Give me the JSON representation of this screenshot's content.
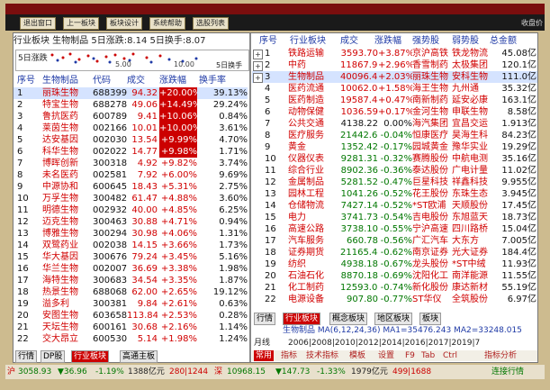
{
  "toolbar": {
    "buttons": [
      "退出窗口",
      "上一板块",
      "板块设计",
      "系统帮助",
      "选股列表"
    ]
  },
  "left": {
    "info_bar": "行业板块  生物制品  5日涨跌:8.14  5日换手:8.07",
    "chart_label": "5日涨跌",
    "axis_ticks": [
      "5.00",
      "10.00"
    ],
    "axis_right": "5日换手",
    "columns": [
      "序号",
      "生物制品",
      "代码",
      "成交",
      "涨跌幅",
      "换手率"
    ],
    "rows": [
      [
        "1",
        "丽珠生物",
        "688399",
        "94.32",
        "+20.00%",
        "39.13%"
      ],
      [
        "2",
        "特宝生物",
        "688278",
        "49.06",
        "+14.49%",
        "29.24%"
      ],
      [
        "3",
        "鲁抗医药",
        "600789",
        "9.41",
        "+10.06%",
        "0.84%"
      ],
      [
        "4",
        "莱茵生物",
        "002166",
        "10.01",
        "+10.00%",
        "3.61%"
      ],
      [
        "5",
        "达安基因",
        "002030",
        "13.54",
        "+9.99%",
        "4.70%"
      ],
      [
        "6",
        "科华生物",
        "002022",
        "14.77",
        "+9.98%",
        "1.71%"
      ],
      [
        "7",
        "博晖创新",
        "300318",
        "4.92",
        "+9.82%",
        "3.74%"
      ],
      [
        "8",
        "未名医药",
        "002581",
        "7.92",
        "+6.00%",
        "9.69%"
      ],
      [
        "9",
        "中源协和",
        "600645",
        "18.43",
        "+5.31%",
        "2.75%"
      ],
      [
        "10",
        "万孚生物",
        "300482",
        "61.47",
        "+4.88%",
        "3.60%"
      ],
      [
        "11",
        "明德生物",
        "002932",
        "40.00",
        "+4.85%",
        "6.25%"
      ],
      [
        "12",
        "迈克生物",
        "300463",
        "30.88",
        "+4.71%",
        "0.94%"
      ],
      [
        "13",
        "博雅生物",
        "300294",
        "30.98",
        "+4.06%",
        "1.31%"
      ],
      [
        "14",
        "双鹭药业",
        "002038",
        "14.15",
        "+3.66%",
        "1.73%"
      ],
      [
        "15",
        "华大基因",
        "300676",
        "79.24",
        "+3.45%",
        "5.16%"
      ],
      [
        "16",
        "华兰生物",
        "002007",
        "36.69",
        "+3.38%",
        "1.98%"
      ],
      [
        "17",
        "海特生物",
        "300683",
        "34.54",
        "+3.35%",
        "1.87%"
      ],
      [
        "18",
        "热景生物",
        "688068",
        "62.00",
        "+2.65%",
        "19.12%"
      ],
      [
        "19",
        "溢多利",
        "300381",
        "9.84",
        "+2.61%",
        "0.63%"
      ],
      [
        "20",
        "安图生物",
        "603658",
        "113.84",
        "+2.53%",
        "0.28%"
      ],
      [
        "21",
        "天坛生物",
        "600161",
        "30.68",
        "+2.16%",
        "1.14%"
      ],
      [
        "22",
        "交大昂立",
        "600530",
        "5.14",
        "+1.98%",
        "1.24%"
      ]
    ],
    "tabs": [
      "行情",
      "DP股",
      "行业板块",
      "高通主板"
    ]
  },
  "right": {
    "columns": [
      "序号",
      "行业板块",
      "成交",
      "涨跌幅",
      "强势股",
      "弱势股",
      "总金额"
    ],
    "rows": [
      [
        "1",
        "铁路运输",
        "3593.70",
        "+3.87%",
        "京沪高铁",
        "铁龙物流",
        "45.08亿"
      ],
      [
        "2",
        "中药",
        "11867.99",
        "+2.96%",
        "香雪制药",
        "太极集团",
        "120.1亿"
      ],
      [
        "3",
        "生物制品",
        "40096.41",
        "+2.03%",
        "丽珠生物",
        "安科生物",
        "111.0亿"
      ],
      [
        "4",
        "医药流通",
        "10062.04",
        "+1.58%",
        "海王生物",
        "九州通",
        "35.32亿"
      ],
      [
        "5",
        "医药制造",
        "19587.44",
        "+0.47%",
        "南新制药",
        "延安必康",
        "163.1亿"
      ],
      [
        "6",
        "动物保健",
        "1036.59",
        "+0.17%",
        "金河生物",
        "申联生物",
        "8.58亿"
      ],
      [
        "7",
        "公共交通",
        "4138.22",
        "0.00%",
        "海汽集团",
        "宜昌交运",
        "1.913亿"
      ],
      [
        "8",
        "医疗服务",
        "21442.61",
        "-0.04%",
        "恒康医疗",
        "昊海生科",
        "84.23亿"
      ],
      [
        "9",
        "黄金",
        "1352.42",
        "-0.17%",
        "园城黄金",
        "豫华实业",
        "19.29亿"
      ],
      [
        "10",
        "仪器仪表",
        "9281.31",
        "-0.32%",
        "赛腾股份",
        "中航电测",
        "35.16亿"
      ],
      [
        "11",
        "综合行业",
        "8902.36",
        "-0.36%",
        "泰达股份",
        "广电计量",
        "11.02亿"
      ],
      [
        "12",
        "金属制品",
        "5281.52",
        "-0.47%",
        "巨星科技",
        "祥鑫科技",
        "9.955亿"
      ],
      [
        "13",
        "园林工程",
        "1041.26",
        "-0.52%",
        "花王股份",
        "东珠生态",
        "3.945亿"
      ],
      [
        "14",
        "仓储物流",
        "7427.14",
        "-0.52%",
        "*ST欧浦",
        "天顺股份",
        "17.45亿"
      ],
      [
        "15",
        "电力",
        "3741.73",
        "-0.54%",
        "吉电股份",
        "东旭蓝天",
        "18.73亿"
      ],
      [
        "16",
        "高速公路",
        "3738.10",
        "-0.55%",
        "宁沪高速",
        "四川路桥",
        "15.04亿"
      ],
      [
        "17",
        "汽车服务",
        "660.78",
        "-0.56%",
        "广汇汽车",
        "大东方",
        "7.005亿"
      ],
      [
        "18",
        "证券期货",
        "21165.44",
        "-0.62%",
        "南京证券",
        "光大证券",
        "184.4亿"
      ],
      [
        "19",
        "纺织",
        "4938.18",
        "-0.67%",
        "龙头股份",
        "*ST中绒",
        "11.93亿"
      ],
      [
        "20",
        "石油石化",
        "8870.18",
        "-0.69%",
        "沈阳化工",
        "南洋能源",
        "11.55亿"
      ],
      [
        "21",
        "化工制药",
        "12593.05",
        "-0.74%",
        "新化股份",
        "康达新材",
        "55.19亿"
      ],
      [
        "22",
        "电源设备",
        "907.80",
        "-0.77%",
        "ST华仪",
        "全筑股份",
        "6.97亿"
      ]
    ],
    "tabs": [
      "行情",
      "行业板块",
      "概念板块",
      "地区板块",
      "板块"
    ],
    "ma_line": "生物制品   MA(6,12,24,36)  MA1=35476.243  MA2=33248.015",
    "years": "2006|2008|2010|2012|2014|2016|2017|2019|7",
    "yaxis_label": "月线",
    "nav_items": [
      "常用",
      "指标",
      "技术指标",
      "模板",
      "设置",
      "F9",
      "Tab",
      "Ctrl",
      "指标分析"
    ]
  },
  "status": {
    "sh_label": "沪",
    "sh_value": "3058.93",
    "sh_change": "▼36.96",
    "sh_pct": "-1.19%",
    "sh_amount": "1388亿元",
    "sh_counts": "280|1244",
    "sz_label": "深",
    "sz_value": "10968.15",
    "sz_change": "▼147.73",
    "sz_pct": "-1.33%",
    "sz_amount": "1979亿元",
    "sz_counts": "499|1688",
    "conn": "连接行情"
  },
  "corner": "收盘价"
}
